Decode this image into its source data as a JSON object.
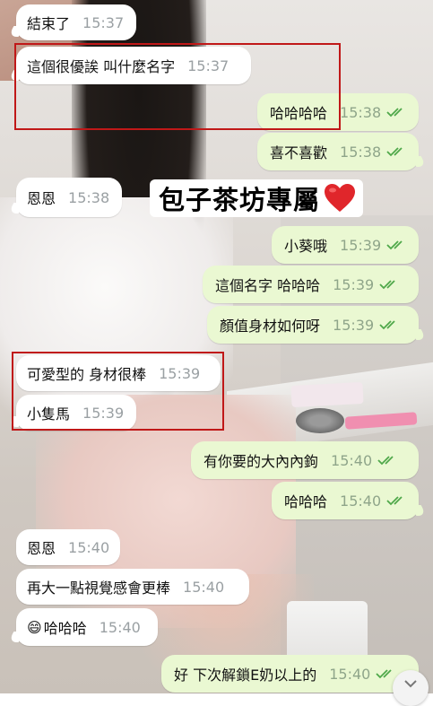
{
  "chat": {
    "messages": [
      {
        "dir": "in",
        "text": "結束了",
        "time": "15:37"
      },
      {
        "dir": "in",
        "text": "這個很優誒 叫什麼名字",
        "time": "15:37"
      },
      {
        "dir": "out",
        "text": "哈哈哈哈",
        "time": "15:38",
        "read": true
      },
      {
        "dir": "out",
        "text": "喜不喜歡",
        "time": "15:38",
        "read": true
      },
      {
        "dir": "in",
        "text": "恩恩",
        "time": "15:38"
      },
      {
        "dir": "out",
        "text": "小葵哦",
        "time": "15:39",
        "read": true
      },
      {
        "dir": "out",
        "text": "這個名字 哈哈哈",
        "time": "15:39",
        "read": true
      },
      {
        "dir": "out",
        "text": "顏值身材如何呀",
        "time": "15:39",
        "read": true
      },
      {
        "dir": "in",
        "text": "可愛型的 身材很棒",
        "time": "15:39"
      },
      {
        "dir": "in",
        "text": "小隻馬",
        "time": "15:39"
      },
      {
        "dir": "out",
        "text": "有你要的大內內鉤",
        "time": "15:40",
        "read": true
      },
      {
        "dir": "out",
        "text": "哈哈哈",
        "time": "15:40",
        "read": true
      },
      {
        "dir": "in",
        "text": "恩恩",
        "time": "15:40"
      },
      {
        "dir": "in",
        "text": "再大一點視覺感會更棒",
        "time": "15:40"
      },
      {
        "dir": "in",
        "text": "哈哈哈",
        "emoji": "😄",
        "time": "15:40"
      },
      {
        "dir": "out",
        "text": "好 下次解鎖E奶以上的",
        "time": "15:40",
        "read": true
      }
    ]
  },
  "watermark": {
    "text": "包子茶坊專屬",
    "icon": "red-heart-icon"
  },
  "colors": {
    "incoming_bg": "#ffffff",
    "outgoing_bg": "#eaf8d2",
    "read_tick": "#4fa84a",
    "highlight_box": "#c01818"
  },
  "icons": {
    "read_receipt": "double-check-icon",
    "scroll": "chevron-down-icon"
  }
}
